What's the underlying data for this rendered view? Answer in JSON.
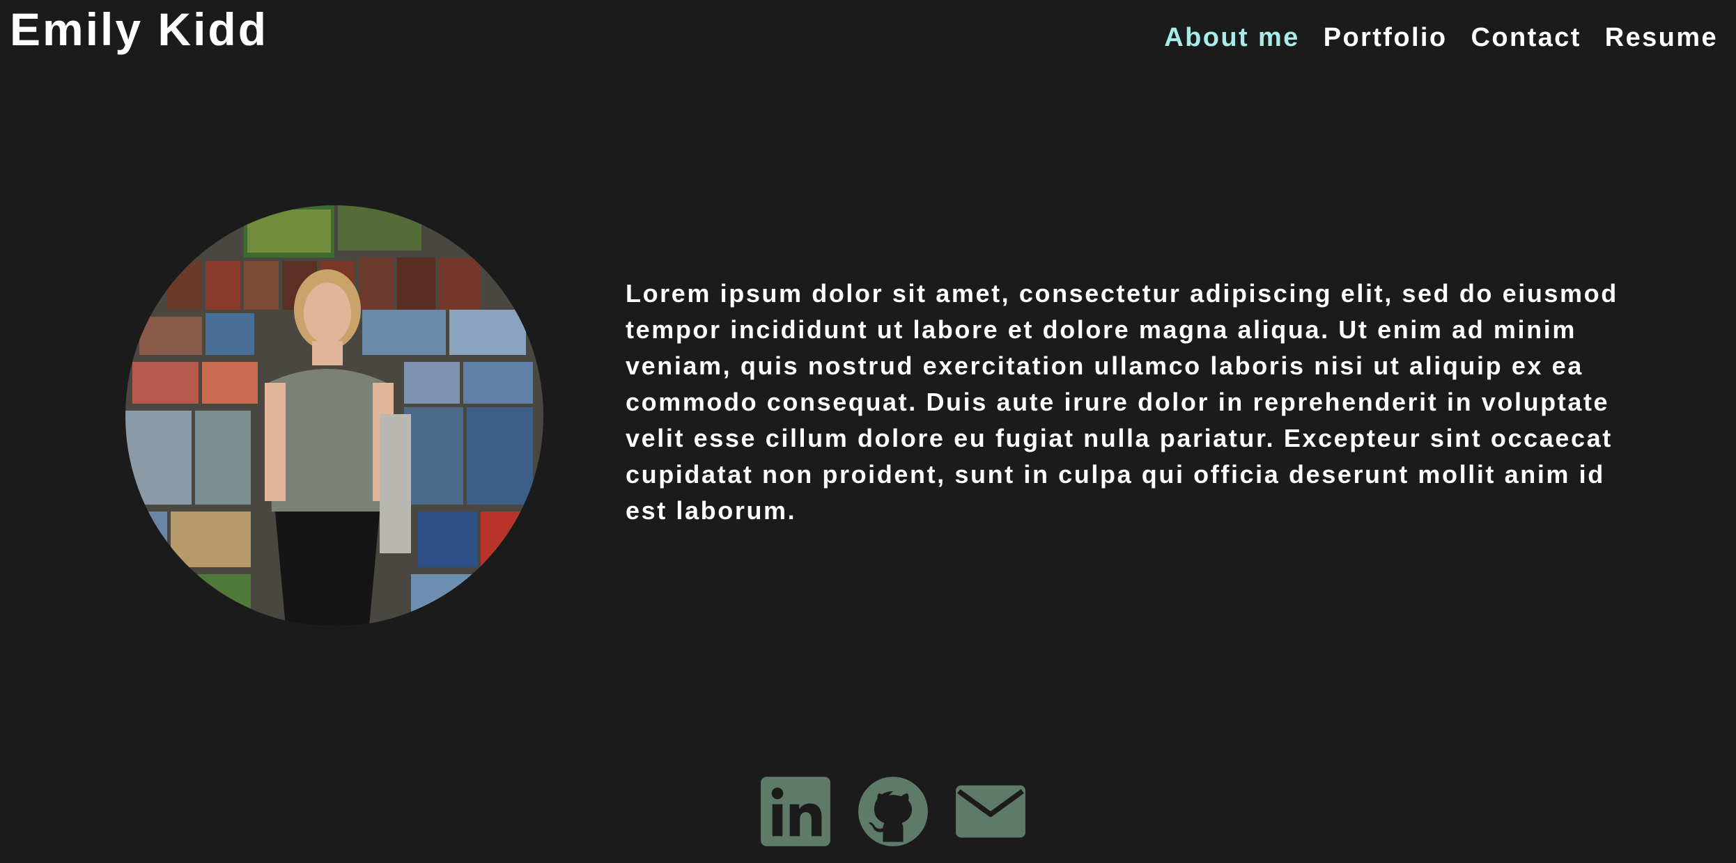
{
  "header": {
    "brand": "Emily Kidd",
    "nav": [
      {
        "label": "About me",
        "active": true
      },
      {
        "label": "Portfolio",
        "active": false
      },
      {
        "label": "Contact",
        "active": false
      },
      {
        "label": "Resume",
        "active": false
      }
    ]
  },
  "about": {
    "bio": "Lorem ipsum dolor sit amet, consectetur adipiscing elit, sed do eiusmod tempor incididunt ut labore et dolore magna aliqua. Ut enim ad minim veniam, quis nostrud exercitation ullamco laboris nisi ut aliquip ex ea commodo consequat. Duis aute irure dolor in reprehenderit in voluptate velit esse cillum dolore eu fugiat nulla pariatur. Excepteur sint occaecat cupidatat non proident, sunt in culpa qui officia deserunt mollit anim id est laborum."
  },
  "socials": [
    {
      "icon": "linkedin-icon"
    },
    {
      "icon": "github-icon"
    },
    {
      "icon": "email-icon"
    }
  ],
  "colors": {
    "background": "#1b1b1b",
    "text": "#ffffff",
    "accent": "#a8ece8",
    "icon": "#5e7b6a"
  }
}
